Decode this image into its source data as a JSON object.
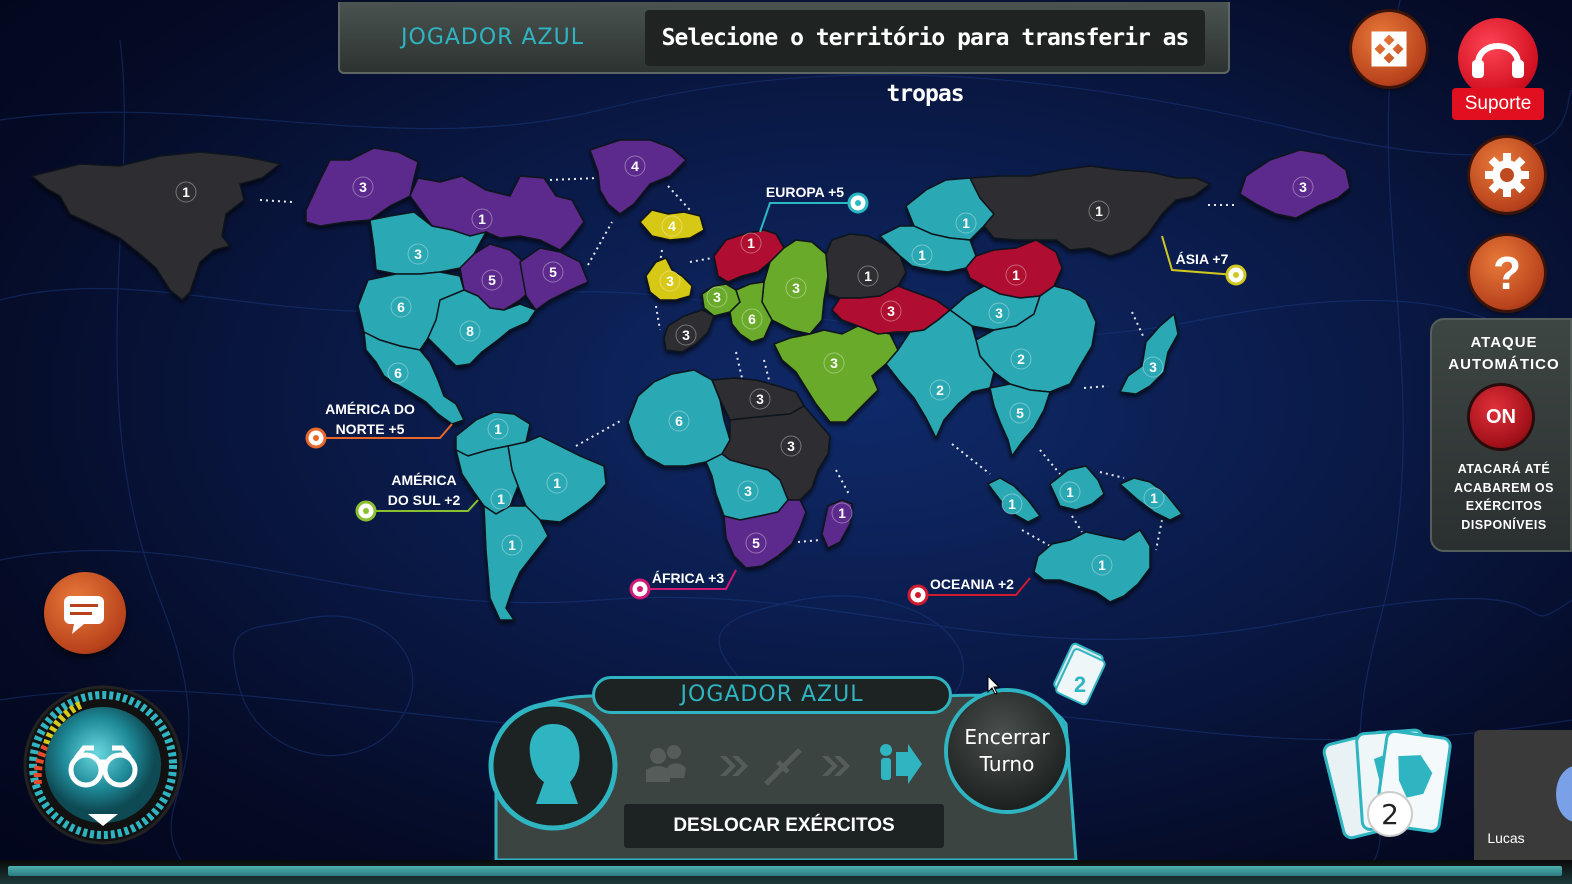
{
  "banner": {
    "player": "JOGADOR AZUL",
    "message": "Selecione o território para transferir as tropas"
  },
  "right_buttons": {
    "fullscreen_icon": "fullscreen-icon",
    "support_label": "Suporte",
    "settings_icon": "gear-icon",
    "help_icon": "question-icon"
  },
  "auto_attack": {
    "title_line1": "ATAQUE",
    "title_line2": "AUTOMÁTICO",
    "toggle": "ON",
    "desc_line1": "ATACARÁ ATÉ",
    "desc_line2": "ACABAREM OS",
    "desc_line3": "EXÉRCITOS",
    "desc_line4": "DISPONÍVEIS"
  },
  "continents": {
    "north_america_line1": "AMÉRICA DO",
    "north_america_line2": "NORTE +5",
    "south_america_line1": "AMÉRICA",
    "south_america_line2": "DO SUL +2",
    "europe": "EUROPA +5",
    "africa": "ÁFRICA +3",
    "asia": "ÁSIA +7",
    "oceania": "OCEANIA +2"
  },
  "players": {
    "blue": "#2aa8b4",
    "purple": "#5c2a8c",
    "gray": "#2e2e33",
    "red": "#b01030",
    "green": "#6aaa2a",
    "yellow": "#d8c818"
  },
  "territories": [
    {
      "id": "alaska",
      "owner": "gray",
      "troops": "1"
    },
    {
      "id": "mackenzie",
      "owner": "purple",
      "troops": "3"
    },
    {
      "id": "greenland",
      "owner": "purple",
      "troops": "4"
    },
    {
      "id": "labrador",
      "owner": "purple",
      "troops": "1"
    },
    {
      "id": "vancouver",
      "owner": "blue",
      "troops": "3"
    },
    {
      "id": "ottawa",
      "owner": "purple",
      "troops": "5"
    },
    {
      "id": "quebec",
      "owner": "purple",
      "troops": "5"
    },
    {
      "id": "california",
      "owner": "blue",
      "troops": "6"
    },
    {
      "id": "new_york",
      "owner": "blue",
      "troops": "8"
    },
    {
      "id": "mexico",
      "owner": "blue",
      "troops": "6"
    },
    {
      "id": "venezuela",
      "owner": "blue",
      "troops": "1"
    },
    {
      "id": "brazil",
      "owner": "blue",
      "troops": "1"
    },
    {
      "id": "peru",
      "owner": "blue",
      "troops": "1"
    },
    {
      "id": "argentina",
      "owner": "blue",
      "troops": "1"
    },
    {
      "id": "iceland",
      "owner": "yellow",
      "troops": "4"
    },
    {
      "id": "england",
      "owner": "yellow",
      "troops": "3"
    },
    {
      "id": "sweden",
      "owner": "red",
      "troops": "1"
    },
    {
      "id": "france",
      "owner": "green",
      "troops": "3"
    },
    {
      "id": "germany",
      "owner": "green",
      "troops": "6"
    },
    {
      "id": "poland",
      "owner": "green",
      "troops": "3"
    },
    {
      "id": "portugal",
      "owner": "gray",
      "troops": "3"
    },
    {
      "id": "moscow",
      "owner": "gray",
      "troops": "1"
    },
    {
      "id": "algeria",
      "owner": "blue",
      "troops": "6"
    },
    {
      "id": "egypt",
      "owner": "gray",
      "troops": "3"
    },
    {
      "id": "sudan",
      "owner": "gray",
      "troops": "3"
    },
    {
      "id": "congo",
      "owner": "blue",
      "troops": "3"
    },
    {
      "id": "south_africa",
      "owner": "purple",
      "troops": "5"
    },
    {
      "id": "madagascar",
      "owner": "purple",
      "troops": "1"
    },
    {
      "id": "middle_east",
      "owner": "green",
      "troops": "3"
    },
    {
      "id": "aral",
      "owner": "red",
      "troops": "3"
    },
    {
      "id": "omsk",
      "owner": "blue",
      "troops": "1"
    },
    {
      "id": "dudinka",
      "owner": "blue",
      "troops": "1"
    },
    {
      "id": "siberia",
      "owner": "gray",
      "troops": "1"
    },
    {
      "id": "vladivostok",
      "owner": "purple",
      "troops": "3"
    },
    {
      "id": "mongolia",
      "owner": "red",
      "troops": "1"
    },
    {
      "id": "tchita",
      "owner": "blue",
      "troops": "3"
    },
    {
      "id": "china",
      "owner": "blue",
      "troops": "2"
    },
    {
      "id": "india",
      "owner": "blue",
      "troops": "2"
    },
    {
      "id": "vietnam",
      "owner": "blue",
      "troops": "5"
    },
    {
      "id": "japan",
      "owner": "blue",
      "troops": "3"
    },
    {
      "id": "sumatra",
      "owner": "blue",
      "troops": "1"
    },
    {
      "id": "borneo",
      "owner": "blue",
      "troops": "1"
    },
    {
      "id": "new_guinea",
      "owner": "blue",
      "troops": "1"
    },
    {
      "id": "australia",
      "owner": "blue",
      "troops": "1"
    }
  ],
  "bottom": {
    "player": "JOGADOR AZUL",
    "phase": "DESLOCAR EXÉRCITOS",
    "end_turn_line1": "Encerrar",
    "end_turn_line2": "Turno",
    "cards_drawn": "2",
    "cards_count": "2",
    "opponent_name": "Lucas"
  }
}
